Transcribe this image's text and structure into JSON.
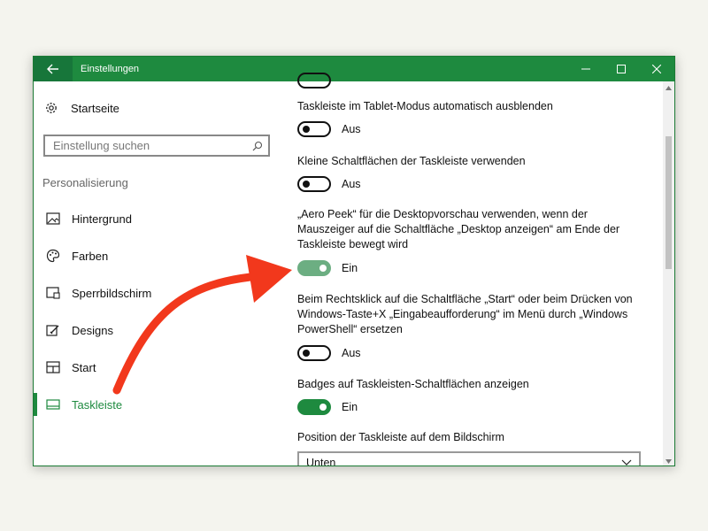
{
  "window": {
    "title": "Einstellungen"
  },
  "sidebar": {
    "home_label": "Startseite",
    "search_placeholder": "Einstellung suchen",
    "section_label": "Personalisierung",
    "items": [
      {
        "label": "Hintergrund",
        "icon": "image-icon"
      },
      {
        "label": "Farben",
        "icon": "palette-icon"
      },
      {
        "label": "Sperrbildschirm",
        "icon": "lock-screen-icon"
      },
      {
        "label": "Designs",
        "icon": "brush-icon"
      },
      {
        "label": "Start",
        "icon": "start-icon"
      },
      {
        "label": "Taskleiste",
        "icon": "taskbar-icon",
        "active": true
      }
    ]
  },
  "settings": [
    {
      "label": "Taskleiste im Tablet-Modus automatisch ausblenden",
      "state": "Aus",
      "on": false
    },
    {
      "label": "Kleine Schaltflächen der Taskleiste verwenden",
      "state": "Aus",
      "on": false
    },
    {
      "label": "„Aero Peek“ für die Desktopvorschau verwenden, wenn der Mauszeiger auf die Schaltfläche „Desktop anzeigen“ am Ende der Taskleiste bewegt wird",
      "state": "Ein",
      "on": true
    },
    {
      "label": "Beim Rechtsklick auf die Schaltfläche „Start“ oder beim Drücken von Windows-Taste+X „Eingabeaufforderung“ im Menü durch „Windows PowerShell“ ersetzen",
      "state": "Aus",
      "on": false
    },
    {
      "label": "Badges auf Taskleisten-Schaltflächen anzeigen",
      "state": "Ein",
      "on": true
    }
  ],
  "position": {
    "label": "Position der Taskleiste auf dem Bildschirm",
    "value": "Unten"
  },
  "colors": {
    "accent": "#1e8a3f",
    "annotation_arrow": "#f2381c"
  }
}
